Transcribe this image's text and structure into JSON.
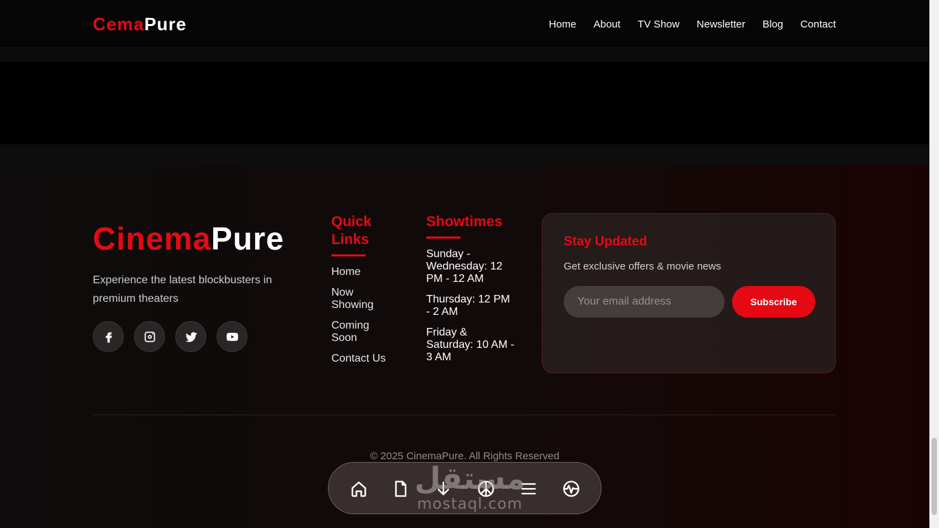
{
  "navbar": {
    "brand_red": "Cema",
    "brand_white": "Pure",
    "links": [
      "Home",
      "About",
      "TV Show",
      "Newsletter",
      "Blog",
      "Contact"
    ]
  },
  "footer": {
    "brand_red": "Cinema",
    "brand_white": "Pure",
    "description": "Experience the latest blockbusters in premium theaters",
    "socials": [
      "facebook-icon",
      "instagram-icon",
      "twitter-icon",
      "youtube-icon"
    ],
    "quick_links": {
      "title": "Quick Links",
      "items": [
        "Home",
        "Now Showing",
        "Coming Soon",
        "Contact Us"
      ]
    },
    "showtimes": {
      "title": "Showtimes",
      "items": [
        "Sunday - Wednesday: 12 PM - 12 AM",
        "Thursday: 12 PM - 2 AM",
        "Friday & Saturday: 10 AM - 3 AM"
      ]
    },
    "newsletter": {
      "title": "Stay Updated",
      "subtitle": "Get exclusive offers & movie news",
      "placeholder": "Your email address",
      "button": "Subscribe"
    },
    "copyright": "© 2025 CinemaPure. All Rights Reserved"
  },
  "dock": {
    "icons": [
      "home-icon",
      "file-icon",
      "download-icon",
      "peace-icon",
      "menu-icon",
      "activity-icon"
    ]
  },
  "watermark": {
    "arabic": "مستقل",
    "latin": "mostaql.com"
  },
  "colors": {
    "accent": "#e50914",
    "background": "#000000"
  }
}
